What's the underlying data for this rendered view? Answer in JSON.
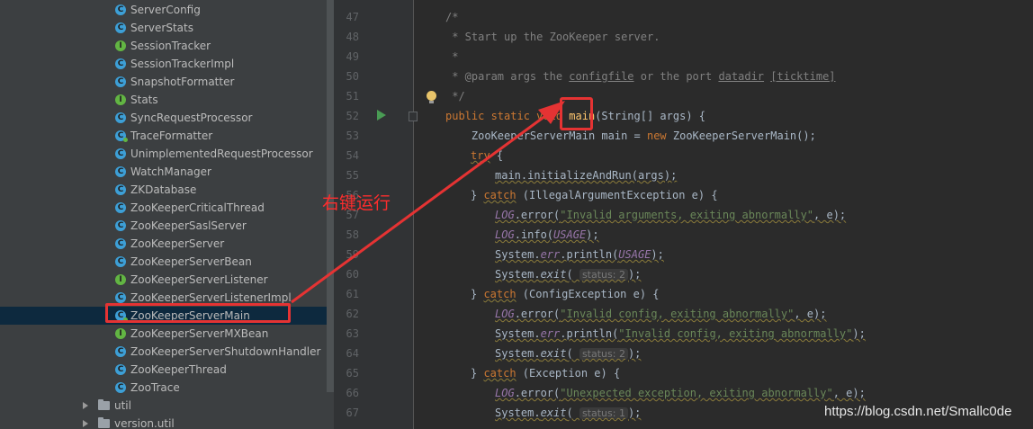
{
  "project_tree": {
    "items": [
      {
        "name": "ServerConfig",
        "kind": "C",
        "icon": "class-icon"
      },
      {
        "name": "ServerStats",
        "kind": "C",
        "icon": "class-icon"
      },
      {
        "name": "SessionTracker",
        "kind": "I",
        "icon": "interface-icon"
      },
      {
        "name": "SessionTrackerImpl",
        "kind": "C",
        "icon": "class-icon"
      },
      {
        "name": "SnapshotFormatter",
        "kind": "C",
        "icon": "class-icon"
      },
      {
        "name": "Stats",
        "kind": "I",
        "icon": "interface-icon"
      },
      {
        "name": "SyncRequestProcessor",
        "kind": "C",
        "icon": "class-icon"
      },
      {
        "name": "TraceFormatter",
        "kind": "C",
        "icon": "runnable-class-icon"
      },
      {
        "name": "UnimplementedRequestProcessor",
        "kind": "C",
        "icon": "class-icon"
      },
      {
        "name": "WatchManager",
        "kind": "C",
        "icon": "class-icon"
      },
      {
        "name": "ZKDatabase",
        "kind": "C",
        "icon": "class-icon"
      },
      {
        "name": "ZooKeeperCriticalThread",
        "kind": "C",
        "icon": "class-icon"
      },
      {
        "name": "ZooKeeperSaslServer",
        "kind": "C",
        "icon": "class-icon"
      },
      {
        "name": "ZooKeeperServer",
        "kind": "C",
        "icon": "class-icon"
      },
      {
        "name": "ZooKeeperServerBean",
        "kind": "C",
        "icon": "class-icon"
      },
      {
        "name": "ZooKeeperServerListener",
        "kind": "I",
        "icon": "interface-icon"
      },
      {
        "name": "ZooKeeperServerListenerImpl",
        "kind": "C",
        "icon": "class-icon"
      },
      {
        "name": "ZooKeeperServerMain",
        "kind": "C",
        "icon": "runnable-class-icon",
        "selected": true
      },
      {
        "name": "ZooKeeperServerMXBean",
        "kind": "I",
        "icon": "interface-icon"
      },
      {
        "name": "ZooKeeperServerShutdownHandler",
        "kind": "C",
        "icon": "class-icon"
      },
      {
        "name": "ZooKeeperThread",
        "kind": "C",
        "icon": "class-icon"
      },
      {
        "name": "ZooTrace",
        "kind": "C",
        "icon": "class-icon"
      }
    ],
    "packages": [
      {
        "name": "util",
        "icon": "folder-icon"
      },
      {
        "name": "version.util",
        "icon": "folder-icon"
      }
    ]
  },
  "editor": {
    "line_numbers": [
      "47",
      "48",
      "49",
      "50",
      "51",
      "52",
      "53",
      "54",
      "55",
      "56",
      "57",
      "58",
      "59",
      "60",
      "61",
      "62",
      "63",
      "64",
      "65",
      "66",
      "67"
    ],
    "code": {
      "l47": "/*",
      "l48": " * Start up the ZooKeeper server.",
      "l49": " *",
      "l50_pre": " * @param args the ",
      "l50_cfg": "configfile",
      "l50_mid": " or the port ",
      "l50_dd": "datadir",
      "l50_sp": " ",
      "l50_tt": "[ticktime]",
      "l51": " */",
      "l52_kw": "public static void ",
      "l52_main": "main",
      "l52_rest": "(String[] args) {",
      "l53_a": "    ZooKeeperServerMain main = ",
      "l53_kw": "new",
      "l53_b": " ZooKeeperServerMain();",
      "l54_kw": "try",
      "l54_rest": " {",
      "l55": "main.initializeAndRun(args);",
      "l56_a": "} ",
      "l56_kw": "catch",
      "l56_b": " (IllegalArgumentException e) {",
      "l57_f": "LOG",
      "l57_a": ".error(",
      "l57_s": "\"Invalid arguments, exiting abnormally\"",
      "l57_b": ", e);",
      "l58_f": "LOG",
      "l58_a": ".info(",
      "l58_u": "USAGE",
      "l58_b": ");",
      "l59_a": "System.",
      "l59_err": "err",
      "l59_b": ".println(",
      "l59_u": "USAGE",
      "l59_c": ");",
      "l60_a": "System.",
      "l60_exit": "exit",
      "l60_b": "( ",
      "l60_hint": "status: 2",
      "l60_c": ");",
      "l61_a": "} ",
      "l61_kw": "catch",
      "l61_b": " (ConfigException e) {",
      "l62_f": "LOG",
      "l62_a": ".error(",
      "l62_s": "\"Invalid config, exiting abnormally\"",
      "l62_b": ", e);",
      "l63_a": "System.",
      "l63_err": "err",
      "l63_b": ".println(",
      "l63_s": "\"Invalid config, exiting abnormally\"",
      "l63_c": ");",
      "l64_a": "System.",
      "l64_exit": "exit",
      "l64_b": "( ",
      "l64_hint": "status: 2",
      "l64_c": ");",
      "l65_a": "} ",
      "l65_kw": "catch",
      "l65_b": " (Exception e) {",
      "l66_f": "LOG",
      "l66_a": ".error(",
      "l66_s": "\"Unexpected exception, exiting abnormally\"",
      "l66_b": ", e);",
      "l67_a": "System.",
      "l67_exit": "exit",
      "l67_b": "( ",
      "l67_hint": "status: 1",
      "l67_c": ");"
    }
  },
  "annotation": {
    "callout": "右键运行",
    "color": "#e53333"
  },
  "watermark": "https://blog.csdn.net/Smallc0de",
  "colors": {
    "keyword": "#cc7832",
    "string": "#6a8759",
    "field": "#9876aa",
    "comment": "#808080",
    "selection": "#0d293e"
  }
}
